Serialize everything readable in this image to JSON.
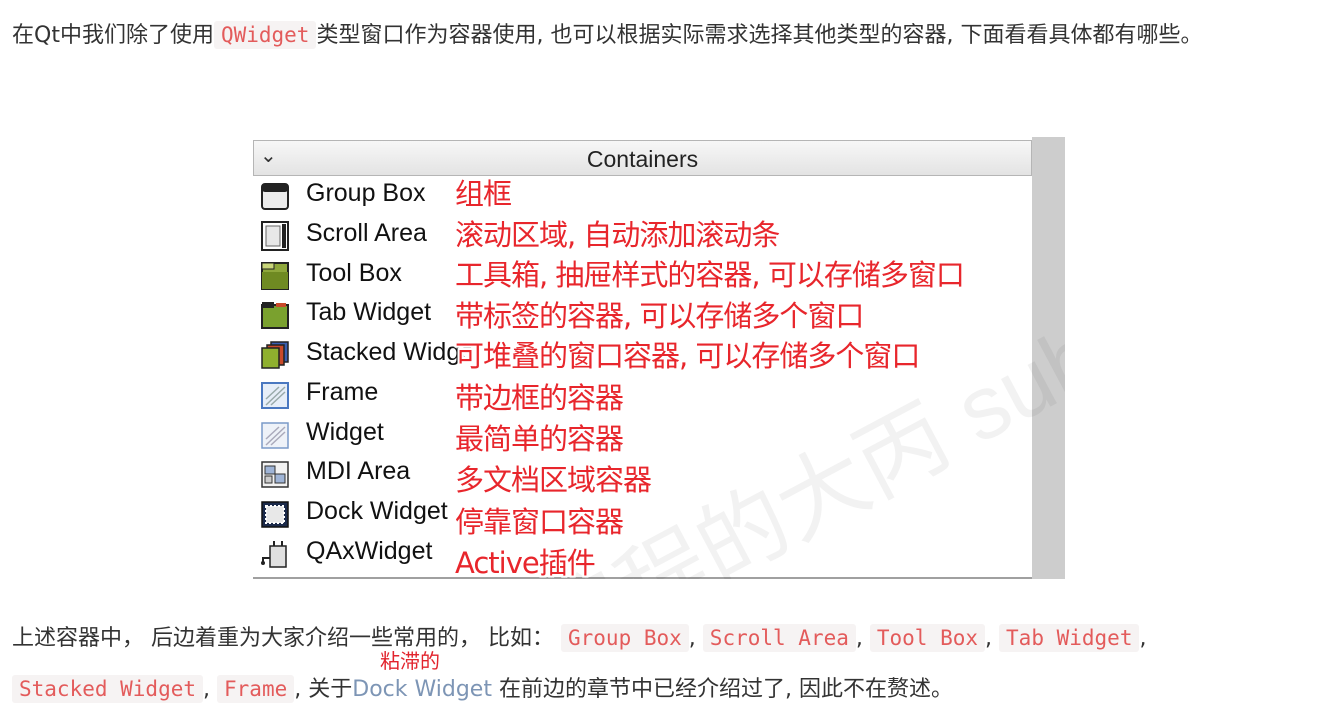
{
  "intro": {
    "part1": "在Qt中我们除了使用",
    "code": "QWidget",
    "part2": "类型窗口作为容器使用, 也可以根据实际需求选择其他类型的容器, 下面看看具体都有哪些。"
  },
  "panel": {
    "header": "Containers",
    "watermark": "爱编程的大丙 subingwen",
    "items": [
      {
        "label": "Group Box",
        "note": "组框",
        "icon": "group-box-icon"
      },
      {
        "label": "Scroll Area",
        "note": "滚动区域, 自动添加滚动条",
        "icon": "scroll-area-icon"
      },
      {
        "label": "Tool Box",
        "note": "工具箱, 抽屉样式的容器, 可以存储多窗口",
        "icon": "tool-box-icon"
      },
      {
        "label": "Tab Widget",
        "note": "带标签的容器, 可以存储多个窗口",
        "icon": "tab-widget-icon"
      },
      {
        "label": "Stacked Widget",
        "note": "可堆叠的窗口容器, 可以存储多个窗口",
        "icon": "stacked-widget-icon"
      },
      {
        "label": "Frame",
        "note": "带边框的容器",
        "icon": "frame-icon"
      },
      {
        "label": "Widget",
        "note": "最简单的容器",
        "icon": "widget-icon"
      },
      {
        "label": "MDI Area",
        "note": "多文档区域容器",
        "icon": "mdi-area-icon"
      },
      {
        "label": "Dock Widget",
        "note": "停靠窗口容器",
        "icon": "dock-widget-icon"
      },
      {
        "label": "QAxWidget",
        "note": "Active插件",
        "icon": "qaxwidget-icon"
      }
    ]
  },
  "summary": {
    "part1": "上述容器中， 后边着重为大家介绍一些常用的， 比如：",
    "codes": [
      "Group Box",
      "Scroll Area",
      "Tool Box",
      "Tab Widget",
      "Stacked Widget",
      "Frame"
    ],
    "sep": ",",
    "part2": "关于",
    "link": "Dock Widget",
    "part3": "在前边的章节中已经介绍过了, 因此不在赘述。",
    "tooltip": "粘滞的"
  },
  "colors": {
    "annotation": "#e8262c",
    "code_text": "#e35b5b",
    "link": "#7d95b5"
  }
}
